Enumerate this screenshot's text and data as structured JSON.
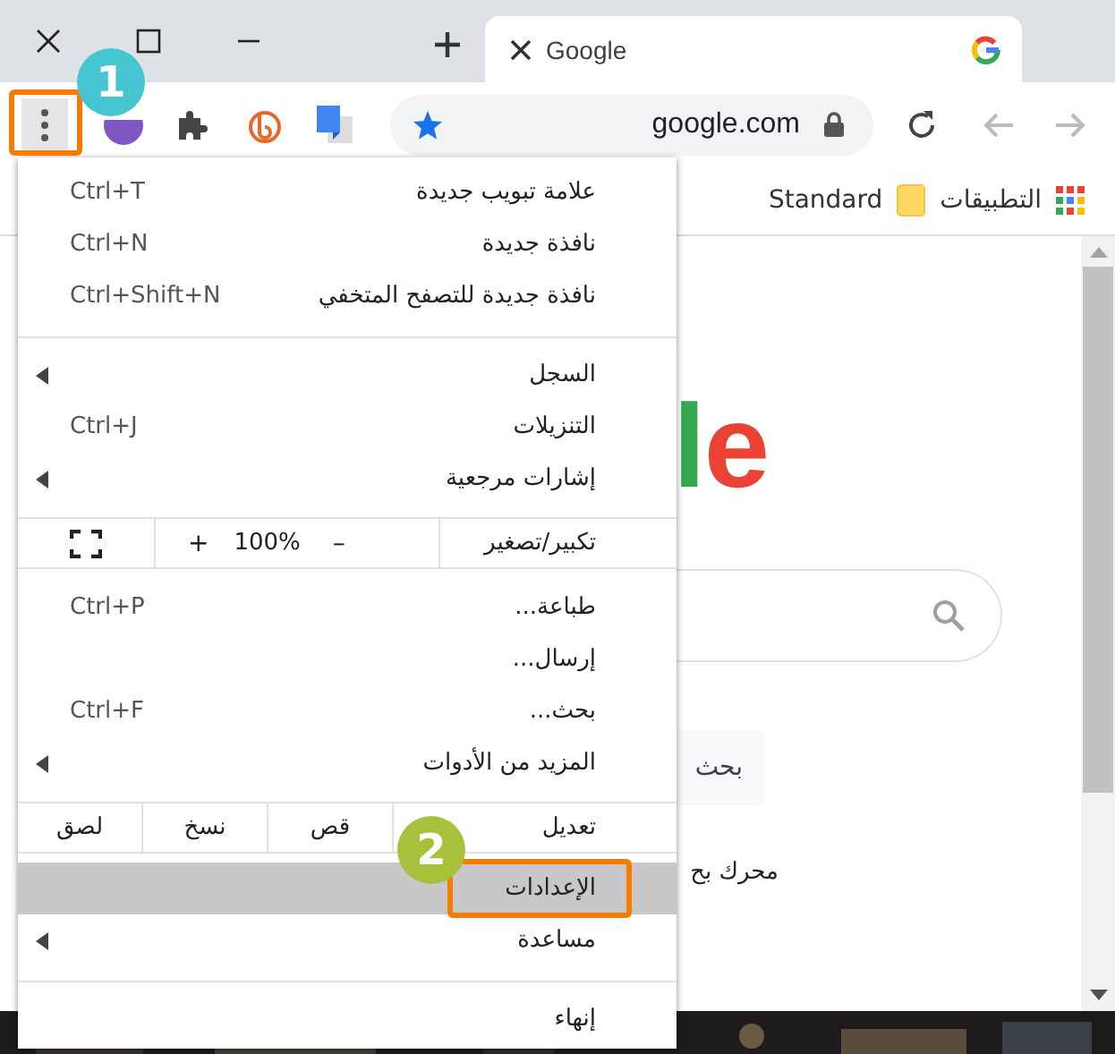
{
  "tabs": [
    {
      "title": "Google",
      "selected": true
    }
  ],
  "toolbar": {
    "address": "google.com"
  },
  "bookmarks": [
    {
      "kind": "apps",
      "label": "التطبيقات"
    },
    {
      "kind": "folder",
      "label": "Standard"
    }
  ],
  "page": {
    "logo": "le",
    "search_button": "بحث",
    "footer_text": "محرك بح"
  },
  "menu": {
    "items": [
      {
        "kind": "item",
        "label": "علامة تبويب جديدة",
        "shortcut": "Ctrl+T",
        "submenu": false,
        "selected": false
      },
      {
        "kind": "item",
        "label": "نافذة جديدة",
        "shortcut": "Ctrl+N",
        "submenu": false,
        "selected": false
      },
      {
        "kind": "item",
        "label": "نافذة جديدة للتصفح المتخفي",
        "shortcut": "Ctrl+Shift+N",
        "submenu": false,
        "selected": false
      },
      {
        "kind": "separator"
      },
      {
        "kind": "item",
        "label": "السجل",
        "submenu": true,
        "selected": false
      },
      {
        "kind": "item",
        "label": "التنزيلات",
        "shortcut": "Ctrl+J",
        "submenu": false,
        "selected": false
      },
      {
        "kind": "item",
        "label": "إشارات مرجعية",
        "submenu": true,
        "selected": false
      },
      {
        "kind": "zoom",
        "label": "تكبير/تصغير",
        "minus": "–",
        "value": "100%",
        "plus": "+"
      },
      {
        "kind": "item",
        "label": "طباعة...",
        "shortcut": "Ctrl+P",
        "submenu": false,
        "selected": false
      },
      {
        "kind": "item",
        "label": "إرسال...",
        "submenu": false,
        "selected": false
      },
      {
        "kind": "item",
        "label": "بحث...",
        "shortcut": "Ctrl+F",
        "submenu": false,
        "selected": false
      },
      {
        "kind": "item",
        "label": "المزيد من الأدوات",
        "submenu": true,
        "selected": false
      },
      {
        "kind": "edit",
        "label": "تعديل",
        "buttons": [
          "قص",
          "نسخ",
          "لصق"
        ]
      },
      {
        "kind": "item",
        "label": "الإعدادات",
        "submenu": false,
        "selected": true
      },
      {
        "kind": "item",
        "label": "مساعدة",
        "submenu": true,
        "selected": false
      },
      {
        "kind": "separator"
      },
      {
        "kind": "item",
        "label": "إنهاء",
        "submenu": false,
        "selected": false
      }
    ]
  },
  "annotations": [
    {
      "number": "1",
      "color": "#45c5d0"
    },
    {
      "number": "2",
      "color": "#a8c13a"
    }
  ]
}
